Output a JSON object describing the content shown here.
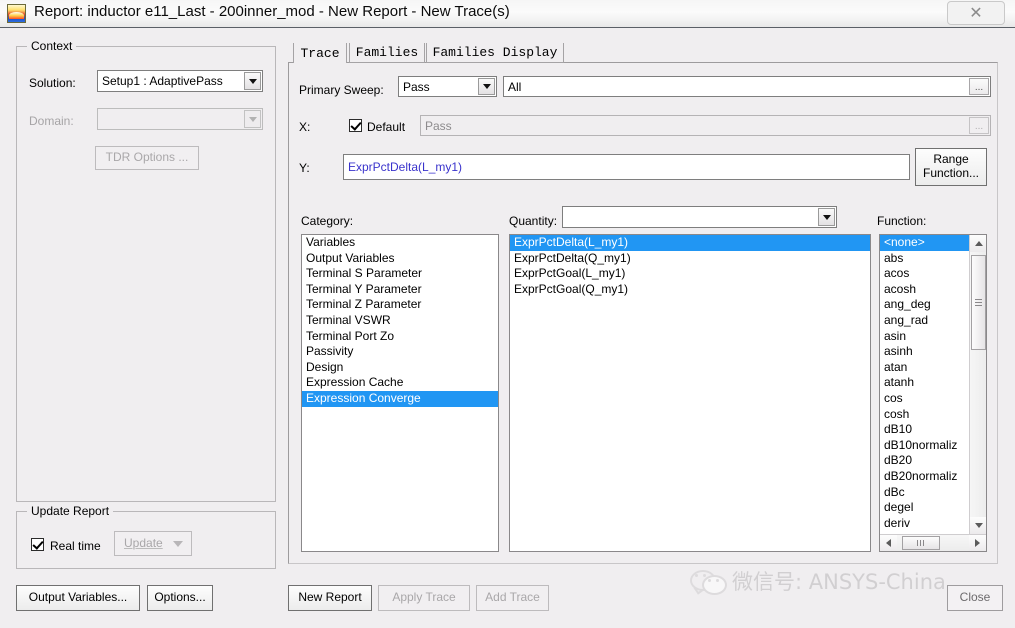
{
  "window": {
    "title": "Report: inductor e11_Last - 200inner_mod - New Report - New Trace(s)",
    "icon_name": "ansys-report-icon",
    "close_glyph": "✕"
  },
  "context": {
    "group_title": "Context",
    "solution_label": "Solution:",
    "solution_value": "Setup1 : AdaptivePass",
    "domain_label": "Domain:",
    "domain_value": "",
    "tdr_options_button": "TDR Options ..."
  },
  "update_report": {
    "group_title": "Update Report",
    "realtime_label": "Real time",
    "realtime_checked": true,
    "update_button": "Update"
  },
  "left_buttons": {
    "output_variables": "Output Variables...",
    "options": "Options..."
  },
  "tabs": [
    {
      "label": "Trace",
      "active": true
    },
    {
      "label": "Families",
      "active": false
    },
    {
      "label": "Families Display",
      "active": false
    }
  ],
  "trace": {
    "primary_sweep_label": "Primary Sweep:",
    "primary_sweep_value": "Pass",
    "primary_sweep_range": "All",
    "x_label": "X:",
    "x_default_label": "Default",
    "x_default_checked": true,
    "x_value": "Pass",
    "y_label": "Y:",
    "y_value": "ExprPctDelta(L_my1)",
    "y_value_color": "#3a33cc",
    "range_function_button": "Range\nFunction...",
    "range_function_line1": "Range",
    "range_function_line2": "Function...",
    "ellipsis_glyph": "..."
  },
  "category": {
    "label": "Category:",
    "items": [
      "Variables",
      "Output Variables",
      "Terminal S Parameter",
      "Terminal Y Parameter",
      "Terminal Z Parameter",
      "Terminal VSWR",
      "Terminal Port Zo",
      "Passivity",
      "Design",
      "Expression Cache",
      "Expression Converge"
    ],
    "selected_index": 10
  },
  "quantity": {
    "label": "Quantity:",
    "filter_value": "",
    "items": [
      "ExprPctDelta(L_my1)",
      "ExprPctDelta(Q_my1)",
      "ExprPctGoal(L_my1)",
      "ExprPctGoal(Q_my1)"
    ],
    "selected_index": 0
  },
  "function": {
    "label": "Function:",
    "items": [
      "<none>",
      "abs",
      "acos",
      "acosh",
      "ang_deg",
      "ang_rad",
      "asin",
      "asinh",
      "atan",
      "atanh",
      "cos",
      "cosh",
      "dB10",
      "dB10normaliz",
      "dB20",
      "dB20normaliz",
      "dBc",
      "degel",
      "deriv"
    ],
    "selected_index": 0
  },
  "bottom_buttons": {
    "new_report": "New Report",
    "apply_trace": "Apply Trace",
    "add_trace": "Add Trace",
    "close": "Close"
  },
  "watermark": {
    "text": "微信号: ANSYS-China",
    "icon_name": "wechat-icon"
  },
  "colors": {
    "selection": "#2196f3",
    "dialog_bg": "#f0eef0",
    "expression_text": "#3a33cc"
  }
}
